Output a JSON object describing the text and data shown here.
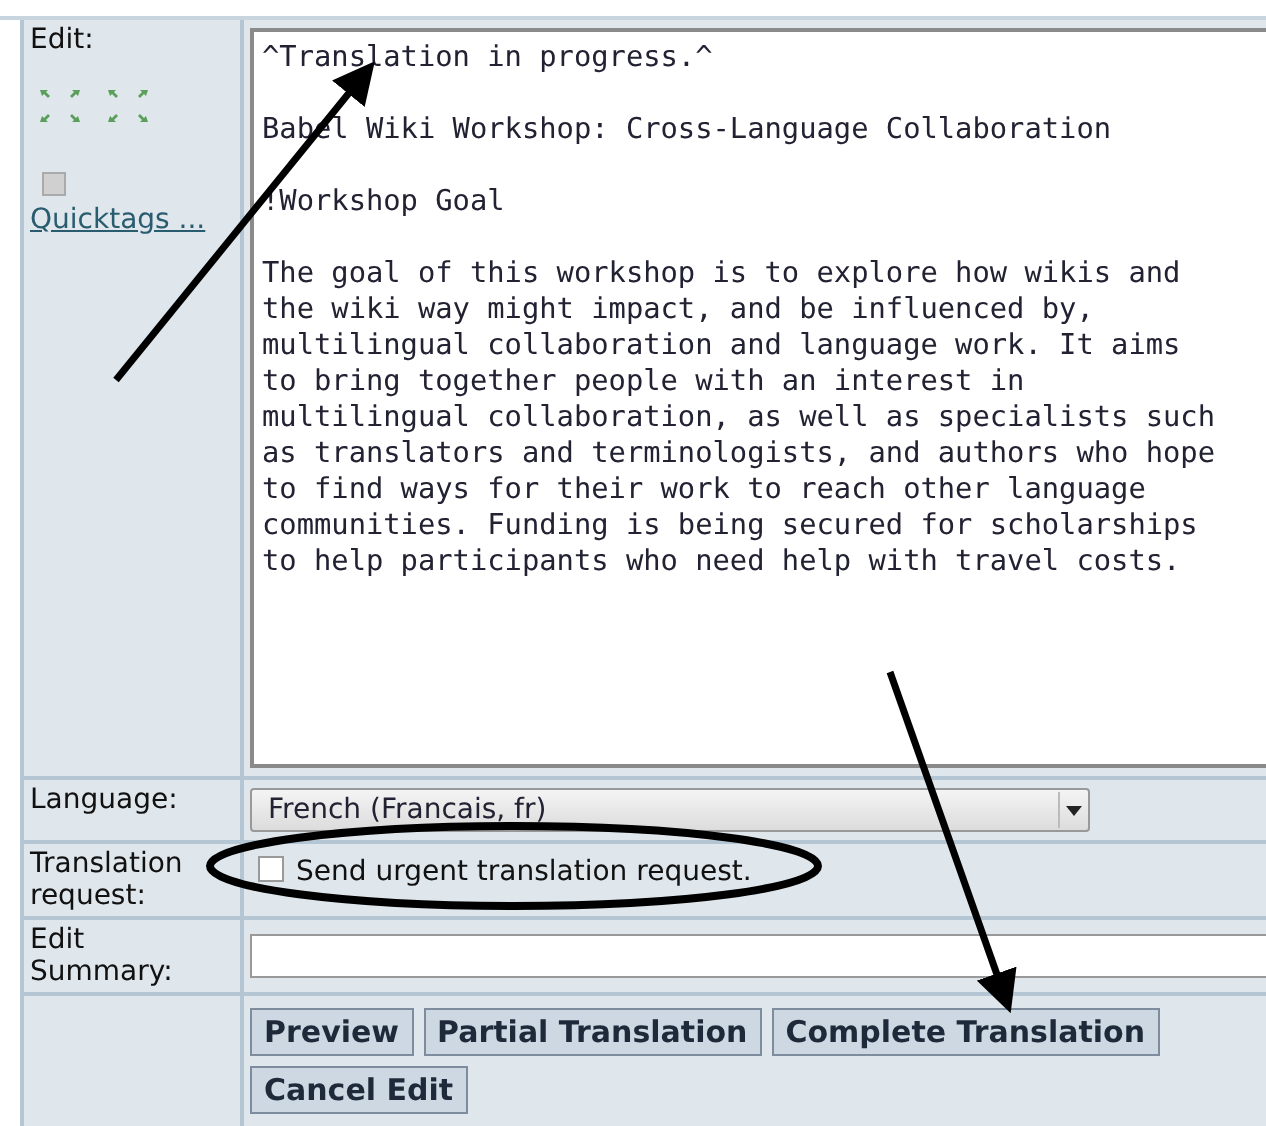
{
  "edit": {
    "label": "Edit:",
    "quicktags_link": "Quicktags ...",
    "paragraphs": [
      [
        "^Translation in progress.^"
      ],
      [
        "Babel Wiki Workshop: Cross-Language Collaboration"
      ],
      [
        "!Workshop Goal"
      ],
      [
        "The goal of this workshop is to explore how wikis and",
        "the wiki way might impact, and be influenced by,",
        "multilingual collaboration and language work. It aims",
        "to bring together people with an interest in",
        "multilingual collaboration, as well as specialists such",
        "as translators and terminologists, and authors who hope",
        "to find ways for their work to reach other language",
        "communities. Funding is being secured for scholarships",
        "to help participants who need help with travel costs."
      ]
    ]
  },
  "language": {
    "label": "Language:",
    "value": "French (Francais, fr)"
  },
  "translation_request": {
    "label": "Translation request:",
    "checkbox_label": "Send urgent translation request.",
    "checked": false
  },
  "edit_summary": {
    "label": "Edit Summary:"
  },
  "buttons": [
    "Preview",
    "Partial Translation",
    "Complete Translation",
    "Cancel Edit"
  ],
  "annotations": [
    {
      "kind": "arrow"
    },
    {
      "kind": "arrow"
    },
    {
      "kind": "ellipse"
    }
  ]
}
